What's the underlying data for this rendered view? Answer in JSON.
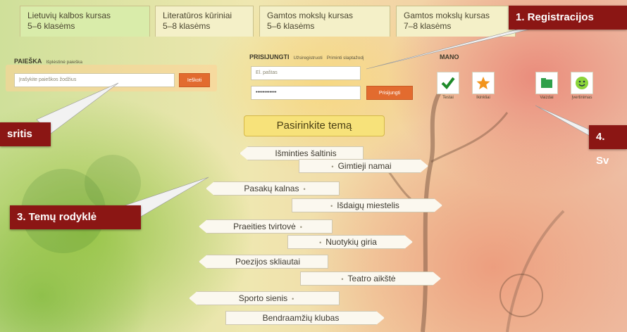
{
  "tabs": [
    {
      "line1": "Lietuvių kalbos kursas",
      "line2": "5–6 klasėms"
    },
    {
      "line1": "Literatūros kūriniai",
      "line2": "5–8 klasėms"
    },
    {
      "line1": "Gamtos mokslų kursas",
      "line2": "5–6 klasėms"
    },
    {
      "line1": "Gamtos mokslų kursas",
      "line2": "7–8 klasėms"
    }
  ],
  "search": {
    "heading": "PAIEŠKA",
    "advanced_link": "Išplėstinė paieška",
    "placeholder": "Įrašykite paieškos žodžius",
    "button_label": "Ieškoti"
  },
  "login": {
    "heading": "PRISIJUNGTI",
    "register_link": "Užsiregistruoti",
    "forgot_link": "Priminti slaptažodį",
    "email_placeholder": "El. paštas",
    "password_value": "••••••••••••",
    "button_label": "Prisijungti"
  },
  "mano": {
    "heading": "MANO",
    "items": [
      {
        "label": "Testai",
        "icon": "checkmark-icon"
      },
      {
        "label": "Ikinkliai",
        "icon": "star-icon"
      },
      {
        "label": "Vaizdai",
        "icon": "folder-icon"
      },
      {
        "label": "Įvertinimas",
        "icon": "smiley-icon"
      }
    ]
  },
  "topics": {
    "title": "Pasirinkite temą",
    "items": [
      "Išminties šaltinis",
      "Gimtieji namai",
      "Pasakų kalnas",
      "Išdaigų miestelis",
      "Praeities tvirtovė",
      "Nuotykių giria",
      "Poezijos skliautai",
      "Teatro aikštė",
      "Sporto sienis",
      "Bendraamžių klubas"
    ]
  },
  "callouts": {
    "registration": "1. Registracijos",
    "search_area": "sritis",
    "topic_index": "3. Temų rodyklė",
    "personal": "4. Sv"
  },
  "colors": {
    "callout_bg": "#8b1614",
    "button_orange": "#e26b2f",
    "title_sign": "#f7e27a"
  }
}
